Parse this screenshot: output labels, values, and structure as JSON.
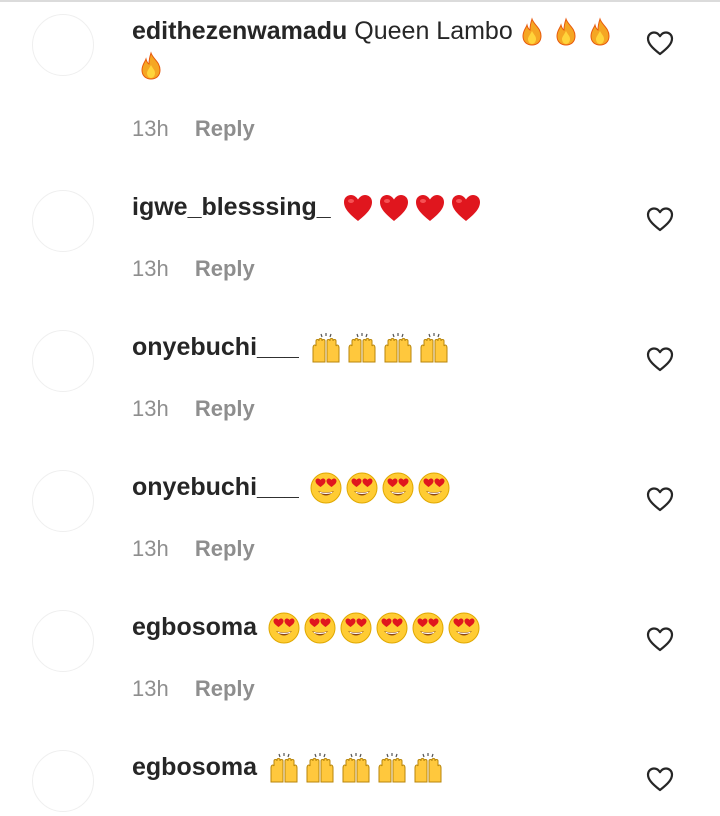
{
  "comments": [
    {
      "username": "edithezenwamadu",
      "text": "Queen Lambo",
      "emojis": [
        "fire",
        "fire",
        "fire",
        "fire"
      ],
      "time": "13h",
      "reply_label": "Reply"
    },
    {
      "username": "igwe_blesssing_",
      "text": "",
      "emojis": [
        "red-heart",
        "red-heart",
        "red-heart",
        "red-heart"
      ],
      "time": "13h",
      "reply_label": "Reply"
    },
    {
      "username": "onyebuchi___",
      "text": "",
      "emojis": [
        "raising-hands",
        "raising-hands",
        "raising-hands",
        "raising-hands"
      ],
      "time": "13h",
      "reply_label": "Reply"
    },
    {
      "username": "onyebuchi___",
      "text": "",
      "emojis": [
        "heart-eyes",
        "heart-eyes",
        "heart-eyes",
        "heart-eyes"
      ],
      "time": "13h",
      "reply_label": "Reply"
    },
    {
      "username": "egbosoma",
      "text": "",
      "emojis": [
        "heart-eyes",
        "heart-eyes",
        "heart-eyes",
        "heart-eyes",
        "heart-eyes",
        "heart-eyes"
      ],
      "time": "13h",
      "reply_label": "Reply"
    },
    {
      "username": "egbosoma",
      "text": "",
      "emojis": [
        "raising-hands",
        "raising-hands",
        "raising-hands",
        "raising-hands",
        "raising-hands"
      ],
      "time": "",
      "reply_label": ""
    }
  ],
  "icons": {
    "like": "heart-outline-icon"
  },
  "colors": {
    "text": "#262626",
    "meta": "#8e8e8e",
    "divider": "#dbdbdb"
  }
}
